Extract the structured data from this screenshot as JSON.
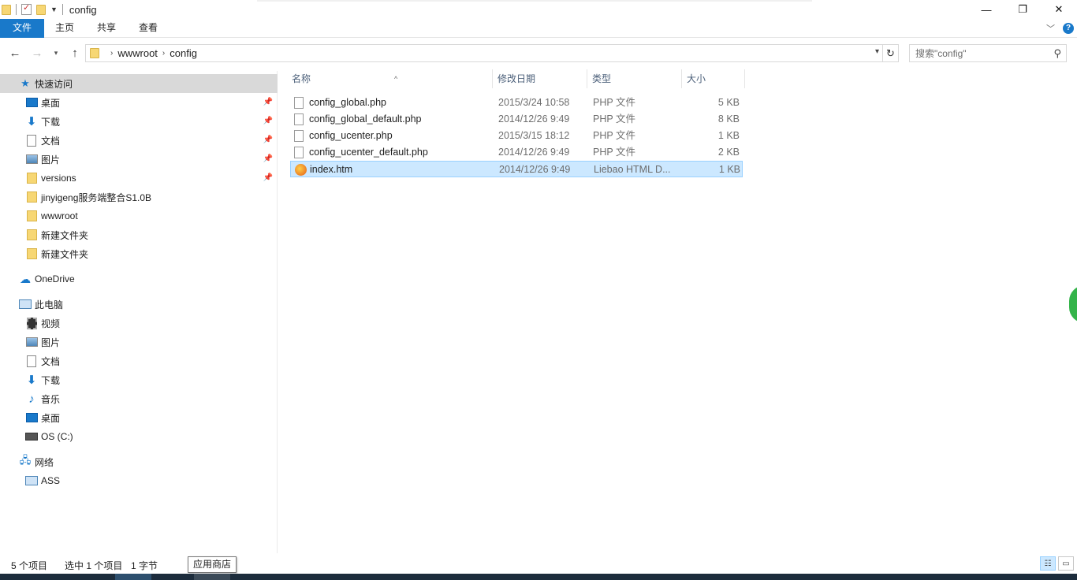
{
  "window": {
    "title": "config",
    "minimize": "—",
    "restore": "❐",
    "close": "✕"
  },
  "ribbon": {
    "file_tab": "文件",
    "tabs": [
      "主页",
      "共享",
      "查看"
    ],
    "collapse_icon": "chevron-down-icon",
    "help_label": "?"
  },
  "nav": {
    "breadcrumb": [
      "wwwroot",
      "config"
    ],
    "search_placeholder": "搜索\"config\""
  },
  "sidebar": {
    "quick_access": {
      "label": "快速访问",
      "items": [
        {
          "label": "桌面",
          "icon": "desktop-icon",
          "pinned": true
        },
        {
          "label": "下载",
          "icon": "download-icon",
          "pinned": true
        },
        {
          "label": "文档",
          "icon": "document-icon",
          "pinned": true
        },
        {
          "label": "图片",
          "icon": "picture-icon",
          "pinned": true
        },
        {
          "label": "versions",
          "icon": "folder-icon",
          "pinned": true
        },
        {
          "label": "jinyigeng服务端整合S1.0B",
          "icon": "folder-icon",
          "pinned": false
        },
        {
          "label": "wwwroot",
          "icon": "folder-icon",
          "pinned": false
        },
        {
          "label": "新建文件夹",
          "icon": "folder-icon",
          "pinned": false
        },
        {
          "label": "新建文件夹",
          "icon": "folder-icon",
          "pinned": false
        }
      ]
    },
    "onedrive": {
      "label": "OneDrive"
    },
    "this_pc": {
      "label": "此电脑",
      "items": [
        {
          "label": "视频",
          "icon": "video-icon"
        },
        {
          "label": "图片",
          "icon": "picture-icon"
        },
        {
          "label": "文档",
          "icon": "document-icon"
        },
        {
          "label": "下载",
          "icon": "download-icon"
        },
        {
          "label": "音乐",
          "icon": "music-icon"
        },
        {
          "label": "桌面",
          "icon": "desktop-icon"
        },
        {
          "label": "OS (C:)",
          "icon": "drive-icon"
        }
      ]
    },
    "network": {
      "label": "网络",
      "items": [
        {
          "label": "ASS",
          "icon": "computer-icon"
        }
      ]
    }
  },
  "filelist": {
    "columns": [
      "名称",
      "修改日期",
      "类型",
      "大小"
    ],
    "rows": [
      {
        "name": "config_global.php",
        "date": "2015/3/24 10:58",
        "type": "PHP 文件",
        "size": "5 KB",
        "selected": false
      },
      {
        "name": "config_global_default.php",
        "date": "2014/12/26 9:49",
        "type": "PHP 文件",
        "size": "8 KB",
        "selected": false
      },
      {
        "name": "config_ucenter.php",
        "date": "2015/3/15 18:12",
        "type": "PHP 文件",
        "size": "1 KB",
        "selected": false
      },
      {
        "name": "config_ucenter_default.php",
        "date": "2014/12/26 9:49",
        "type": "PHP 文件",
        "size": "2 KB",
        "selected": false
      },
      {
        "name": "index.htm",
        "date": "2014/12/26 9:49",
        "type": "Liebao HTML D...",
        "size": "1 KB",
        "selected": true
      }
    ]
  },
  "status": {
    "count": "5 个项目",
    "selected": "选中 1 个项目",
    "size": "1 字节",
    "tooltip": "应用商店"
  },
  "colors": {
    "accent": "#1979ca",
    "selection": "#cce8ff",
    "selection_border": "#99d1ff"
  }
}
